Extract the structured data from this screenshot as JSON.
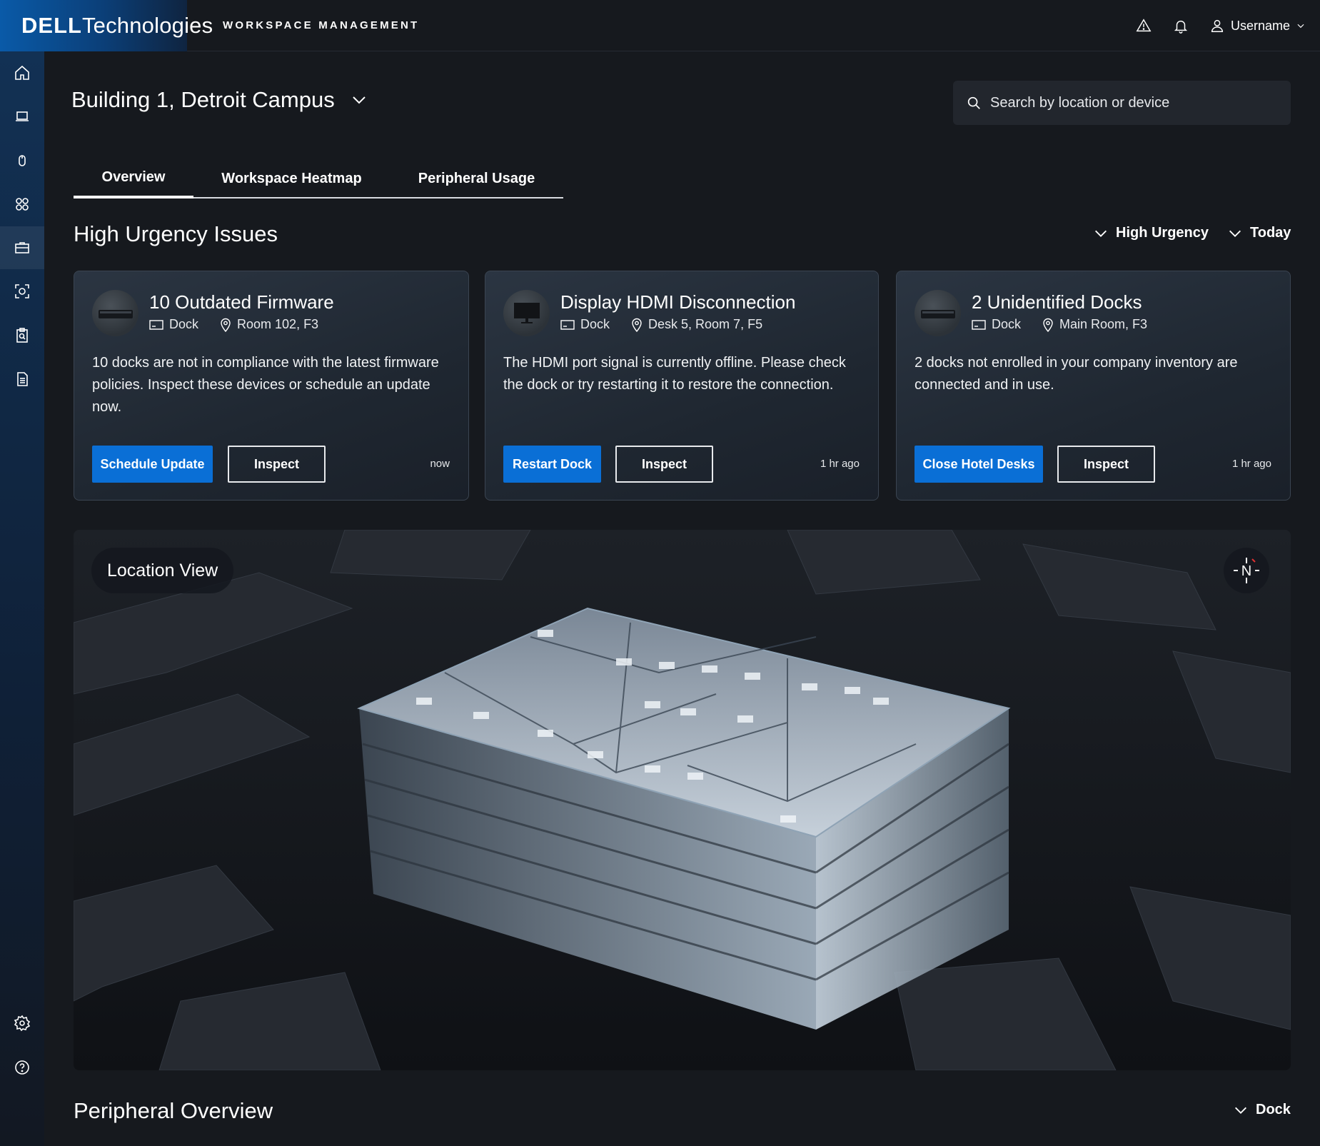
{
  "brand": {
    "dell": "DELL",
    "technologies": "Technologies",
    "app_title": "WORKSPACE MANAGEMENT"
  },
  "topbar": {
    "username": "Username"
  },
  "sidebar": {
    "items": [
      {
        "icon": "home-icon"
      },
      {
        "icon": "laptop-icon"
      },
      {
        "icon": "mouse-icon"
      },
      {
        "icon": "apps-icon"
      },
      {
        "icon": "briefcase-icon",
        "active": true
      },
      {
        "icon": "scan-icon"
      },
      {
        "icon": "clipboard-search-icon"
      },
      {
        "icon": "document-icon"
      }
    ],
    "bottom": [
      {
        "icon": "gear-icon"
      },
      {
        "icon": "help-icon"
      }
    ]
  },
  "header": {
    "title": "Building 1, Detroit Campus",
    "search_placeholder": "Search by location or device"
  },
  "tabs": [
    {
      "label": "Overview",
      "active": true
    },
    {
      "label": "Workspace Heatmap"
    },
    {
      "label": "Peripheral Usage"
    }
  ],
  "issues": {
    "title": "High Urgency Issues",
    "filters": [
      "High Urgency",
      "Today"
    ],
    "cards": [
      {
        "title": "10 Outdated Firmware",
        "device": "Dock",
        "location": "Room 102, F3",
        "body": "10 docks are not in compliance with the latest firmware policies. Inspect these devices or schedule an update now.",
        "primary": "Schedule Update",
        "secondary": "Inspect",
        "time": "now"
      },
      {
        "title": "Display HDMI Disconnection",
        "device": "Dock",
        "location": "Desk 5, Room 7, F5",
        "body": "The HDMI port signal is currently offline. Please check the dock or try restarting it to restore the connection.",
        "primary": "Restart Dock",
        "secondary": "Inspect",
        "time": "1 hr ago"
      },
      {
        "title": "2 Unidentified Docks",
        "device": "Dock",
        "location": "Main Room, F3",
        "body": "2 docks not enrolled in your company inventory are connected and in use.",
        "primary": "Close Hotel Desks",
        "secondary": "Inspect",
        "time": "1 hr ago"
      }
    ]
  },
  "location": {
    "label": "Location View",
    "compass": "N"
  },
  "peripheral": {
    "title": "Peripheral Overview",
    "filter": "Dock"
  },
  "colors": {
    "primary": "#0a6fd6",
    "background": "#16191e",
    "card": "#232b35"
  }
}
